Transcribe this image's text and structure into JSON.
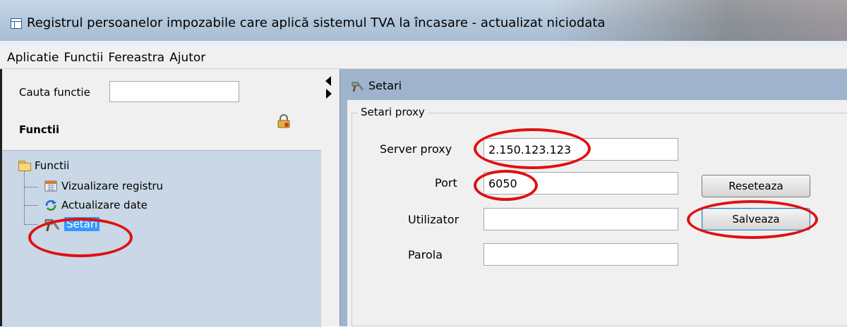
{
  "window": {
    "title": "Registrul persoanelor impozabile care aplică sistemul  TVA la încasare - actualizat niciodata"
  },
  "menu": {
    "items": [
      "Aplicatie",
      "Functii",
      "Fereastra",
      "Ajutor"
    ]
  },
  "left_panel": {
    "search_label": "Cauta functie",
    "search_value": "",
    "section_title": "Functii",
    "tree": {
      "root": "Functii",
      "children": [
        "Vizualizare registru",
        "Actualizare date",
        "Setari"
      ],
      "selected": "Setari"
    }
  },
  "settings_window": {
    "title": "Setari",
    "group_title": "Setari proxy",
    "fields": {
      "server_proxy": {
        "label": "Server proxy",
        "value": "2.150.123.123"
      },
      "port": {
        "label": "Port",
        "value": "6050"
      },
      "utilizator": {
        "label": "Utilizator",
        "value": ""
      },
      "parola": {
        "label": "Parola",
        "value": ""
      }
    },
    "buttons": {
      "reset": "Reseteaza",
      "save": "Salveaza"
    }
  },
  "colors": {
    "annotation": "#e01010",
    "selection": "#3399ff",
    "tree_background": "#c9d7e6",
    "window_frame": "#9fb4cc"
  },
  "icons": [
    "app-icon",
    "lock-icon",
    "folder-icon",
    "calendar-icon",
    "refresh-icon",
    "tools-icon",
    "splitter-arrow-icon"
  ]
}
